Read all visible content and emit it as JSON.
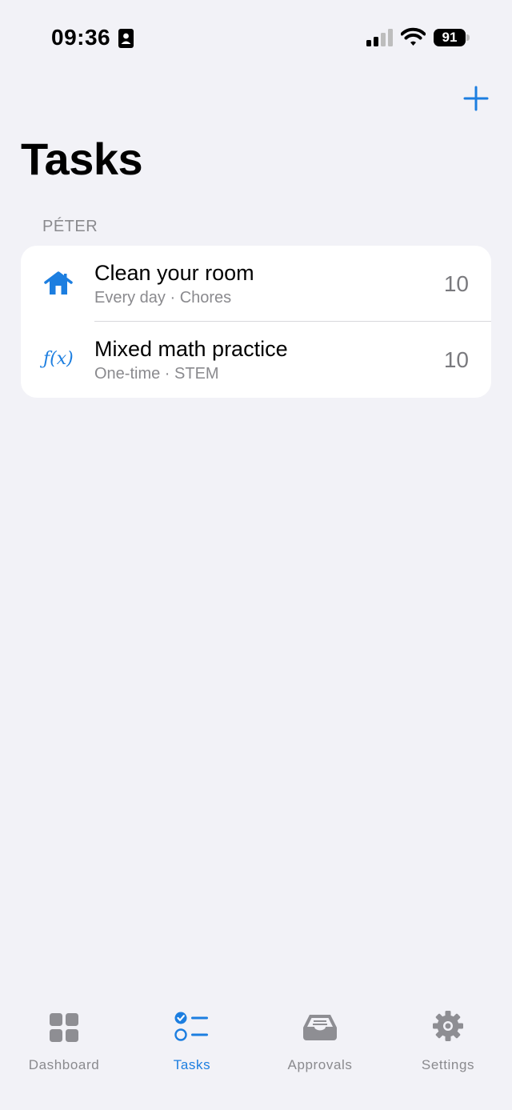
{
  "status_bar": {
    "time": "09:36",
    "battery": "91"
  },
  "header": {
    "title": "Tasks"
  },
  "section": {
    "header": "PÉTER"
  },
  "tasks": [
    {
      "icon": "house-icon",
      "title": "Clean your room",
      "subtitle": "Every day · Chores",
      "points": "10"
    },
    {
      "icon": "function-icon",
      "icon_text": "ƒ(x)",
      "title": "Mixed math practice",
      "subtitle": "One-time · STEM",
      "points": "10"
    }
  ],
  "tab_bar": {
    "items": [
      {
        "label": "Dashboard",
        "icon": "grid-icon",
        "active": false
      },
      {
        "label": "Tasks",
        "icon": "checklist-icon",
        "active": true
      },
      {
        "label": "Approvals",
        "icon": "tray-icon",
        "active": false
      },
      {
        "label": "Settings",
        "icon": "gear-icon",
        "active": false
      }
    ]
  },
  "colors": {
    "accent": "#1C7EE0",
    "background": "#F2F2F7",
    "secondary_text": "#8A8A8E",
    "inactive_icon": "#8E8E93"
  }
}
